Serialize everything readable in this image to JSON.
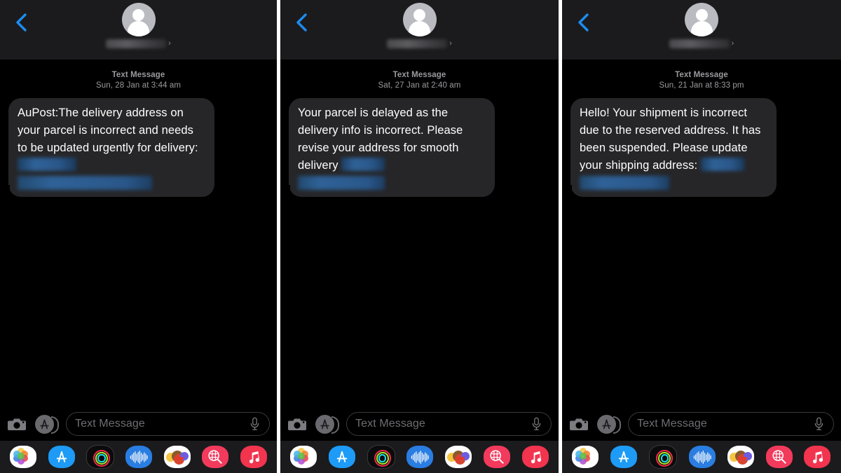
{
  "app": {
    "name": "Messages",
    "platform": "iOS",
    "theme": "dark",
    "accent_color": "#0a84ff",
    "bubble_color": "#262628",
    "header_color": "#1b1b1d",
    "body_color": "#000000"
  },
  "panels": [
    {
      "id": "panel-1",
      "header": {
        "back_icon": "back-chevron-icon",
        "avatar_icon": "person-avatar-icon",
        "contact_name": "",
        "contact_name_redacted": true,
        "contact_chevron": "›"
      },
      "conversation": {
        "service_label": "Text Message",
        "timestamp": "Sun, 28 Jan at 3:44 am",
        "message": {
          "sender": "other",
          "text": "AuPost:The delivery address on your parcel is incorrect and needs to be updated urgently for delivery:",
          "link_redacted": true,
          "inline_redact_width": 84,
          "redact_line_width": 192
        }
      },
      "composer": {
        "camera_icon": "camera-icon",
        "appstore_icon": "app-store-icon",
        "placeholder": "Text Message",
        "value": "",
        "mic_icon": "microphone-icon"
      },
      "app_drawer": [
        {
          "name": "photos-app-icon",
          "label": "Photos"
        },
        {
          "name": "app-store-app-icon",
          "label": "App Store"
        },
        {
          "name": "fitness-rings-app-icon",
          "label": "Fitness"
        },
        {
          "name": "audio-waveform-app-icon",
          "label": "Audio Message"
        },
        {
          "name": "memoji-stickers-app-icon",
          "label": "Memoji Stickers"
        },
        {
          "name": "images-search-app-icon",
          "label": "#images"
        },
        {
          "name": "music-app-icon",
          "label": "Music"
        }
      ]
    },
    {
      "id": "panel-2",
      "header": {
        "back_icon": "back-chevron-icon",
        "avatar_icon": "person-avatar-icon",
        "contact_name": "",
        "contact_name_redacted": true,
        "contact_chevron": "›"
      },
      "conversation": {
        "service_label": "Text Message",
        "timestamp": "Sat, 27 Jan at 2:40 am",
        "message": {
          "sender": "other",
          "text": "Your parcel is delayed as the delivery info is incorrect. Please revise your address for smooth delivery",
          "link_redacted": true,
          "inline_redact_width": 62,
          "redact_line_width": 124
        }
      },
      "composer": {
        "camera_icon": "camera-icon",
        "appstore_icon": "app-store-icon",
        "placeholder": "Text Message",
        "value": "",
        "mic_icon": "microphone-icon"
      },
      "app_drawer": [
        {
          "name": "photos-app-icon",
          "label": "Photos"
        },
        {
          "name": "app-store-app-icon",
          "label": "App Store"
        },
        {
          "name": "fitness-rings-app-icon",
          "label": "Fitness"
        },
        {
          "name": "audio-waveform-app-icon",
          "label": "Audio Message"
        },
        {
          "name": "memoji-stickers-app-icon",
          "label": "Memoji Stickers"
        },
        {
          "name": "images-search-app-icon",
          "label": "#images"
        },
        {
          "name": "music-app-icon",
          "label": "Music"
        }
      ]
    },
    {
      "id": "panel-3",
      "header": {
        "back_icon": "back-chevron-icon",
        "avatar_icon": "person-avatar-icon",
        "contact_name": "",
        "contact_name_redacted": true,
        "contact_chevron": "›"
      },
      "conversation": {
        "service_label": "Text Message",
        "timestamp": "Sun, 21 Jan at 8:33 pm",
        "message": {
          "sender": "other",
          "text": "Hello! Your shipment is incorrect due to the reserved address. It has been suspended. Please update your shipping address:",
          "link_redacted": true,
          "inline_redact_width": 62,
          "redact_line_width": 128
        }
      },
      "composer": {
        "camera_icon": "camera-icon",
        "appstore_icon": "app-store-icon",
        "placeholder": "Text Message",
        "value": "",
        "mic_icon": "microphone-icon"
      },
      "app_drawer": [
        {
          "name": "photos-app-icon",
          "label": "Photos"
        },
        {
          "name": "app-store-app-icon",
          "label": "App Store"
        },
        {
          "name": "fitness-rings-app-icon",
          "label": "Fitness"
        },
        {
          "name": "audio-waveform-app-icon",
          "label": "Audio Message"
        },
        {
          "name": "memoji-stickers-app-icon",
          "label": "Memoji Stickers"
        },
        {
          "name": "images-search-app-icon",
          "label": "#images"
        },
        {
          "name": "music-app-icon",
          "label": "Music"
        }
      ]
    }
  ]
}
